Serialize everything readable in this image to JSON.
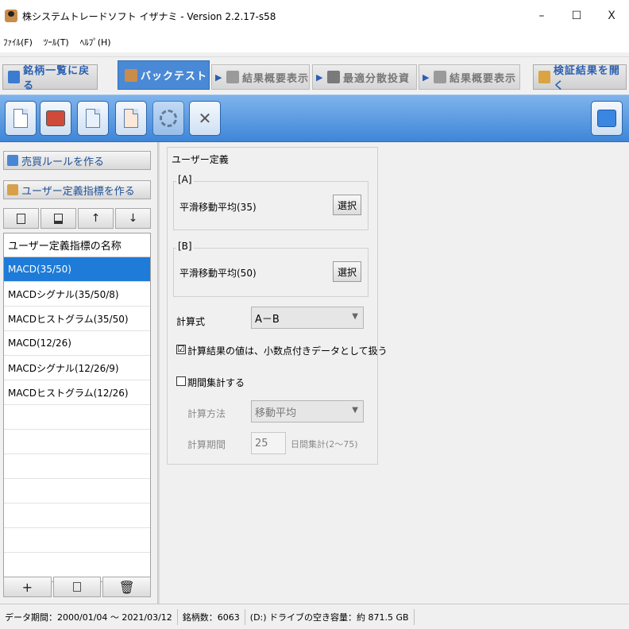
{
  "window": {
    "title": "株システムトレードソフト イザナミ - Version 2.2.17-s58",
    "min": "–",
    "max": "☐",
    "close": "X"
  },
  "menu": [
    "ﾌｧｲﾙ(F)",
    "ﾂｰﾙ(T)",
    "ﾍﾙﾌﾟ(H)"
  ],
  "tabs": {
    "back": "銘柄一覧に戻る",
    "backtest": "バックテスト",
    "summary1": "結果概要表示",
    "optimize": "最適分散投資",
    "summary2": "結果概要表示",
    "open": "検証結果を開く",
    "arrow": "▶"
  },
  "left": {
    "make_rule": "売買ルールを作る",
    "make_indicator": "ユーザー定義指標を作る",
    "list_header": "ユーザー定義指標の名称",
    "items": [
      "MACD(35/50)",
      "MACDシグナル(35/50/8)",
      "MACDヒストグラム(35/50)",
      "MACD(12/26)",
      "MACDシグナル(12/26/9)",
      "MACDヒストグラム(12/26)"
    ],
    "add": "+",
    "trash": "🗑",
    "up": "↑",
    "down": "↓"
  },
  "panel": {
    "title": "ユーザー定義",
    "a_label": "[A]",
    "a_value": "平滑移動平均(35)",
    "select": "選択",
    "b_label": "[B]",
    "b_value": "平滑移動平均(50)",
    "formula_label": "計算式",
    "formula_value": "A－B",
    "decimal_check": "計算結果の値は、小数点付きデータとして扱う",
    "decimal_mark": "☑",
    "period_check": "期間集計する",
    "method_label": "計算方法",
    "method_value": "移動平均",
    "period_label": "計算期間",
    "period_value": "25",
    "period_unit": "日間集計(2～75)"
  },
  "status": {
    "data_period": "データ期間：2000/01/04 ～ 2021/03/12",
    "count": "銘柄数：6063",
    "disk": "(D:) ドライブの空き容量：約 871.5 GB"
  }
}
